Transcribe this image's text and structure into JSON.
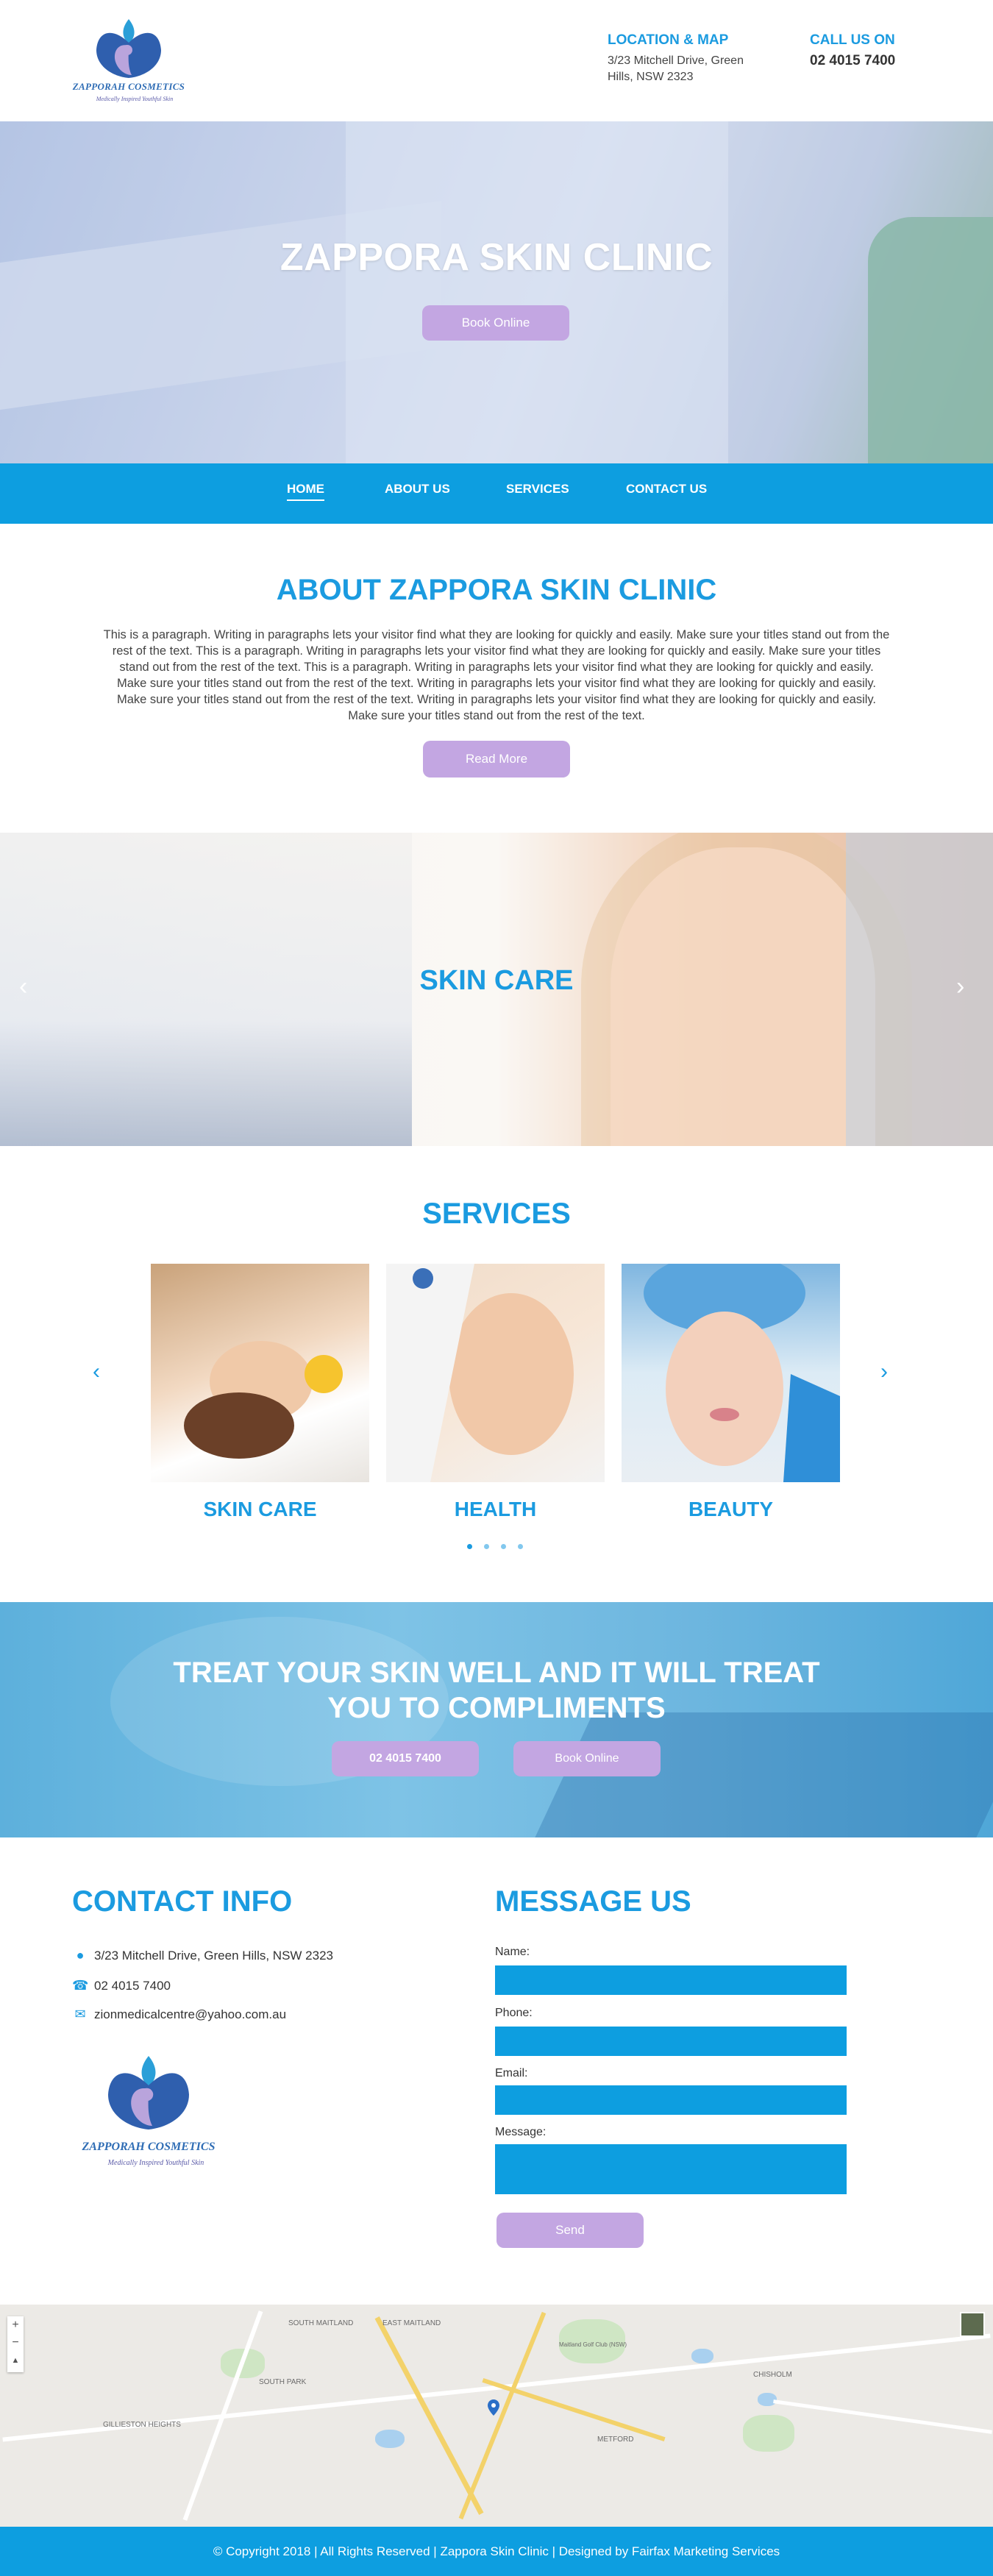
{
  "header": {
    "logo": {
      "brand": "ZAPPORAH COSMETICS",
      "tagline": "Medically Inspired Youthful Skin"
    },
    "location": {
      "title": "LOCATION & MAP",
      "address_line1": "3/23 Mitchell Drive, Green",
      "address_line2": "Hills, NSW 2323"
    },
    "call": {
      "title": "CALL US ON",
      "phone": "02 4015 7400"
    }
  },
  "hero": {
    "title": "ZAPPORA SKIN CLINIC",
    "button": "Book Online"
  },
  "nav": {
    "items": [
      "HOME",
      "ABOUT US",
      "SERVICES",
      "CONTACT US"
    ],
    "active": "HOME"
  },
  "about": {
    "title": "ABOUT ZAPPORA SKIN CLINIC",
    "paragraph": "This is a paragraph. Writing in paragraphs lets your visitor find what they are looking for quickly and easily. Make sure your titles stand out from the rest of the text. This is a paragraph. Writing in paragraphs lets your visitor find what they are looking for quickly and easily. Make sure your titles stand out from the rest of the text. This is a paragraph. Writing in paragraphs lets your visitor find what they are looking for quickly and easily. Make sure your titles stand out from the rest of the text. Writing in paragraphs lets your visitor find what they are looking for quickly and easily. Make sure your titles stand out from the rest of the text. Writing in paragraphs lets your visitor find what they are looking for quickly and easily. Make sure your titles stand out from the rest of the text.",
    "button": "Read More"
  },
  "banner": {
    "title": "SKIN CARE",
    "prev_icon": "chevron-left-icon",
    "next_icon": "chevron-right-icon"
  },
  "services": {
    "title": "SERVICES",
    "items": [
      {
        "label": "SKIN CARE"
      },
      {
        "label": "HEALTH"
      },
      {
        "label": "BEAUTY"
      }
    ],
    "dots": 4,
    "active_dot": 0
  },
  "cta": {
    "line1": "TREAT YOUR SKIN WELL AND IT WILL TREAT",
    "line2": "YOU TO COMPLIMENTS",
    "phone_button": "02 4015 7400",
    "book_button": "Book Online"
  },
  "contact": {
    "title": "CONTACT INFO",
    "address": "3/23 Mitchell Drive, Green Hills, NSW 2323",
    "phone": "02 4015 7400",
    "email": "zionmedicalcentre@yahoo.com.au",
    "logo": {
      "brand": "ZAPPORAH COSMETICS",
      "tagline": "Medically Inspired Youthful Skin"
    }
  },
  "message": {
    "title": "MESSAGE US",
    "labels": {
      "name": "Name:",
      "phone": "Phone:",
      "email": "Email:",
      "message": "Message:"
    },
    "button": "Send"
  },
  "map": {
    "labels": [
      "SOUTH MAITLAND",
      "EAST MAITLAND",
      "SOUTH PARK",
      "GILLIESTON HEIGHTS",
      "CHISHOLM",
      "METFORD",
      "Maitland Golf Club (NSW)"
    ]
  },
  "footer": {
    "text": "© Copyright 2018 | All Rights Reserved | Zappora Skin Clinic | Designed by Fairfax Marketing Services"
  },
  "colors": {
    "accent": "#1b9be0",
    "nav": "#0d9ee0",
    "button": "#c3a6e2"
  }
}
